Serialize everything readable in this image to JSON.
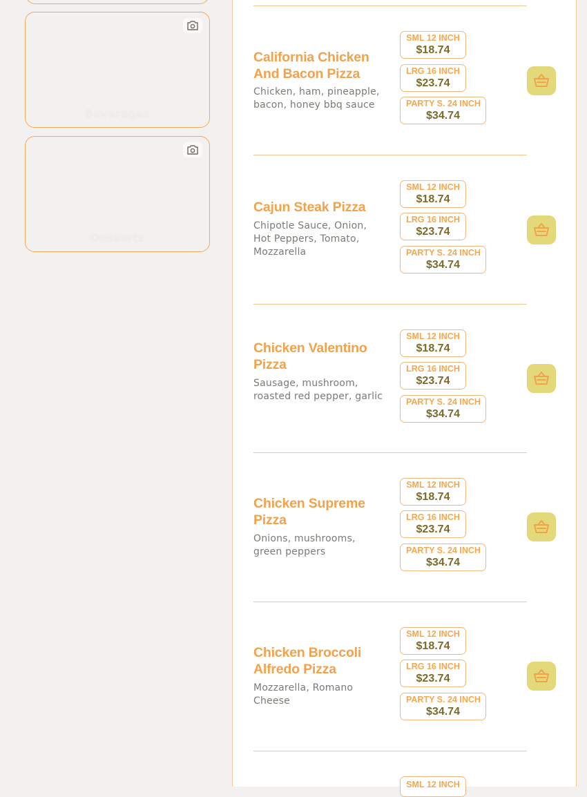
{
  "categories": [
    {
      "label": "Beverages",
      "icon": "camera-icon"
    },
    {
      "label": "Desserts",
      "icon": "camera-icon"
    }
  ],
  "menu_items": [
    {
      "name": "California Chicken And Bacon Pizza",
      "description": "Chicken, ham, pineapple, bacon, honey bbq sauce",
      "prices": [
        {
          "size": "SML 12 INCH",
          "amount": "$18.74"
        },
        {
          "size": "LRG 16 INCH",
          "amount": "$23.74"
        },
        {
          "size": "PARTY S. 24 INCH",
          "amount": "$34.74"
        }
      ]
    },
    {
      "name": "Cajun Steak Pizza",
      "description": "Chipotle Sauce, Onion, Hot Peppers, Tomato, Mozzarella",
      "prices": [
        {
          "size": "SML 12 INCH",
          "amount": "$18.74"
        },
        {
          "size": "LRG 16 INCH",
          "amount": "$23.74"
        },
        {
          "size": "PARTY S. 24 INCH",
          "amount": "$34.74"
        }
      ]
    },
    {
      "name": "Chicken Valentino Pizza",
      "description": "Sausage, mushroom, roasted red pepper, garlic",
      "prices": [
        {
          "size": "SML 12 INCH",
          "amount": "$18.74"
        },
        {
          "size": "LRG 16 INCH",
          "amount": "$23.74"
        },
        {
          "size": "PARTY S. 24 INCH",
          "amount": "$34.74"
        }
      ]
    },
    {
      "name": "Chicken Supreme Pizza",
      "description": "Onions, mushrooms, green peppers",
      "prices": [
        {
          "size": "SML 12 INCH",
          "amount": "$18.74"
        },
        {
          "size": "LRG 16 INCH",
          "amount": "$23.74"
        },
        {
          "size": "PARTY S. 24 INCH",
          "amount": "$34.74"
        }
      ]
    },
    {
      "name": "Chicken Broccoli Alfredo Pizza",
      "description": "Mozzarella, Romano Cheese",
      "prices": [
        {
          "size": "SML 12 INCH",
          "amount": "$18.74"
        },
        {
          "size": "LRG 16 INCH",
          "amount": "$23.74"
        },
        {
          "size": "PARTY S. 24 INCH",
          "amount": "$34.74"
        }
      ]
    }
  ],
  "partial_next_item": {
    "size": "SML 12 INCH"
  },
  "colors": {
    "accent": "#f2a24a",
    "cart": "#e3d97a",
    "border": "#f0b87a"
  }
}
